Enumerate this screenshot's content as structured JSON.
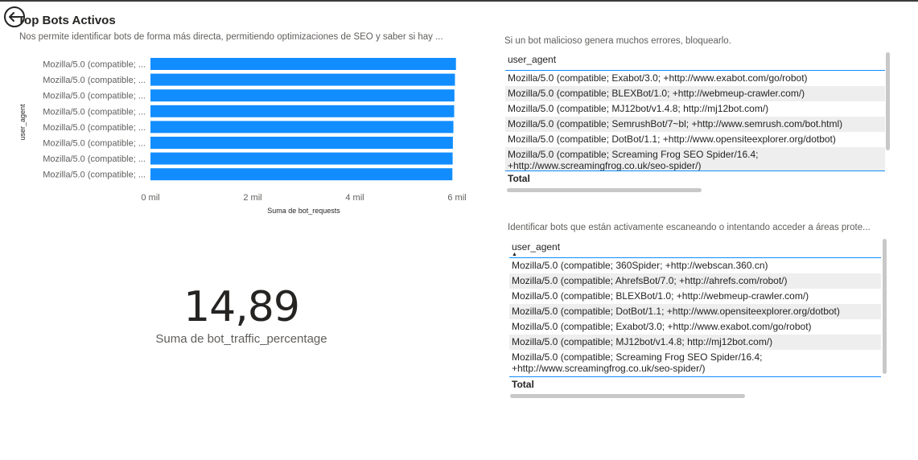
{
  "title": "Top Bots Activos",
  "subtitle": "Nos permite identificar bots de forma más directa, permitiendo optimizaciones de SEO y saber si hay ...",
  "chart_data": {
    "type": "bar",
    "orientation": "horizontal",
    "categories": [
      "Mozilla/5.0 (compatible; ...",
      "Mozilla/5.0 (compatible; ...",
      "Mozilla/5.0 (compatible; ...",
      "Mozilla/5.0 (compatible; ...",
      "Mozilla/5.0 (compatible; ...",
      "Mozilla/5.0 (compatible; ...",
      "Mozilla/5.0 (compatible; ...",
      "Mozilla/5.0 (compatible; ..."
    ],
    "values": [
      5980,
      5960,
      5950,
      5945,
      5930,
      5920,
      5915,
      5910
    ],
    "xlabel": "Suma de bot_requests",
    "ylabel": "user_agent",
    "xlim": [
      0,
      6000
    ],
    "xticks": [
      "0 mil",
      "2 mil",
      "4 mil",
      "6 mil"
    ],
    "xtick_values": [
      0,
      2000,
      4000,
      6000
    ],
    "bar_color": "#118dff"
  },
  "kpi": {
    "value": "14,89",
    "label": "Suma de bot_traffic_percentage"
  },
  "table1": {
    "note": "Si un bot malicioso genera muchos errores, bloquearlo.",
    "header": "user_agent",
    "rows": [
      "Mozilla/5.0 (compatible; Exabot/3.0; +http://www.exabot.com/go/robot)",
      "Mozilla/5.0 (compatible; BLEXBot/1.0; +http://webmeup-crawler.com/)",
      "Mozilla/5.0 (compatible; MJ12bot/v1.4.8; http://mj12bot.com/)",
      "Mozilla/5.0 (compatible; SemrushBot/7~bl; +http://www.semrush.com/bot.html)",
      "Mozilla/5.0 (compatible; DotBot/1.1; +http://www.opensiteexplorer.org/dotbot)",
      "Mozilla/5.0 (compatible; Screaming Frog SEO Spider/16.4; +http://www.screamingfrog.co.uk/seo-spider/)"
    ],
    "total_label": "Total"
  },
  "table2": {
    "note": "Identificar bots que están activamente escaneando o intentando acceder a áreas prote...",
    "header": "user_agent",
    "rows": [
      "Mozilla/5.0 (compatible; 360Spider; +http://webscan.360.cn)",
      "Mozilla/5.0 (compatible; AhrefsBot/7.0; +http://ahrefs.com/robot/)",
      "Mozilla/5.0 (compatible; BLEXBot/1.0; +http://webmeup-crawler.com/)",
      "Mozilla/5.0 (compatible; DotBot/1.1; +http://www.opensiteexplorer.org/dotbot)",
      "Mozilla/5.0 (compatible; Exabot/3.0; +http://www.exabot.com/go/robot)",
      "Mozilla/5.0 (compatible; MJ12bot/v1.4.8; http://mj12bot.com/)",
      "Mozilla/5.0 (compatible; Screaming Frog SEO Spider/16.4; +http://www.screamingfrog.co.uk/seo-spider/)"
    ],
    "total_label": "Total"
  },
  "icons": {
    "back": "back-arrow-icon",
    "sort": "sort-ascending-icon"
  }
}
